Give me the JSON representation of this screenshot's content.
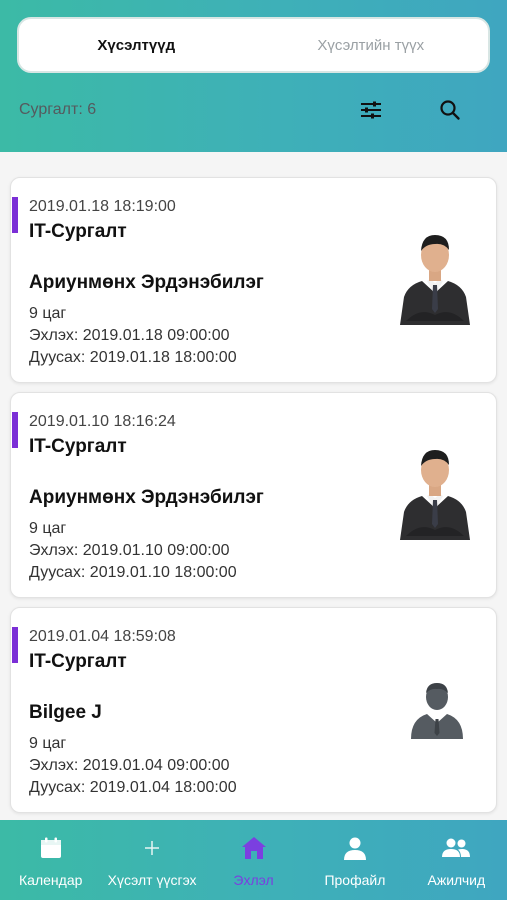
{
  "segmented": {
    "tabs": [
      {
        "label": "Хүсэлтүүд",
        "active": true
      },
      {
        "label": "Хүсэлтийн түүх",
        "active": false
      }
    ]
  },
  "header": {
    "count_label": "Сургалт: 6",
    "icons": [
      "filter-icon",
      "search-icon"
    ]
  },
  "requests": [
    {
      "date": "2019.01.18 18:19:00",
      "title": "IT-Сургалт",
      "name": "Ариунмөнх Эрдэнэбилэг",
      "duration": "9 цаг",
      "start": "Эхлэх: 2019.01.18 09:00:00",
      "end": "Дуусах: 2019.01.18 18:00:00",
      "avatar": "person-photo"
    },
    {
      "date": "2019.01.10 18:16:24",
      "title": "IT-Сургалт",
      "name": "Ариунмөнх Эрдэнэбилэг",
      "duration": "9 цаг",
      "start": "Эхлэх: 2019.01.10 09:00:00",
      "end": "Дуусах: 2019.01.10 18:00:00",
      "avatar": "person-photo"
    },
    {
      "date": "2019.01.04 18:59:08",
      "title": "IT-Сургалт",
      "name": "Bilgee J",
      "duration": "9 цаг",
      "start": "Эхлэх: 2019.01.04 09:00:00",
      "end": "Дуусах: 2019.01.04 18:00:00",
      "avatar": "default-avatar-icon"
    }
  ],
  "tabbar": {
    "items": [
      {
        "label": "Календар",
        "icon": "calendar-icon",
        "active": false
      },
      {
        "label": "Хүсэлт үүсгэх",
        "icon": "plus-icon",
        "active": false
      },
      {
        "label": "Эхлэл",
        "icon": "home-icon",
        "active": true
      },
      {
        "label": "Профайл",
        "icon": "profile-icon",
        "active": false
      },
      {
        "label": "Ажилчид",
        "icon": "employees-icon",
        "active": false
      }
    ]
  },
  "colors": {
    "header_gradient_start": "#3cbaa6",
    "header_gradient_end": "#3fa6c0",
    "accent_purple": "#7b2fd6",
    "active_tab": "#7b3fe0"
  }
}
